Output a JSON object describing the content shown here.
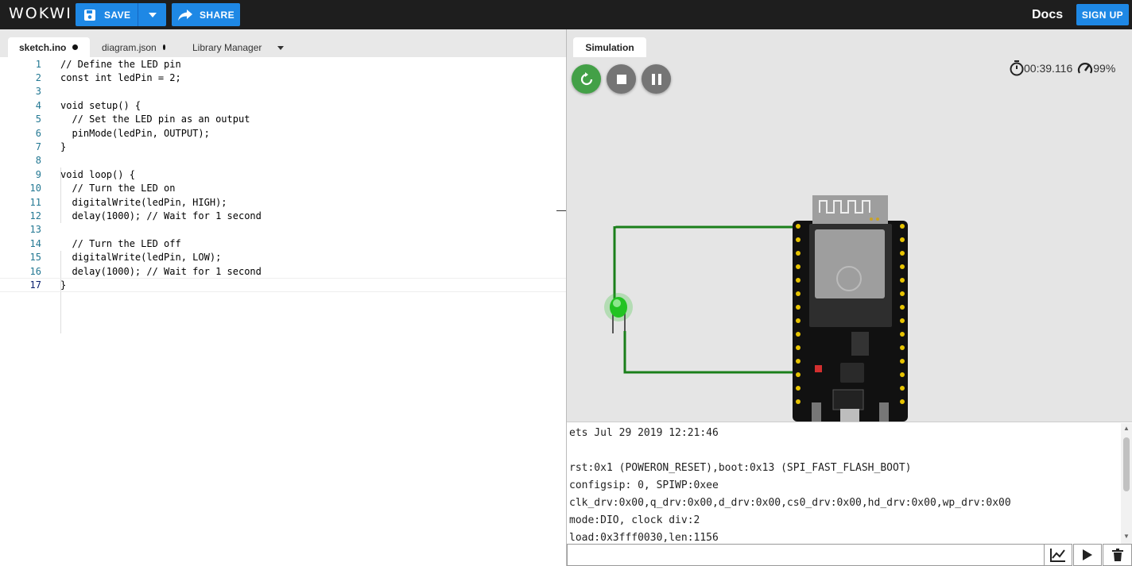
{
  "app": {
    "logo": "WOKWI"
  },
  "toolbar": {
    "save_label": "SAVE",
    "share_label": "SHARE",
    "docs_label": "Docs",
    "signup_label": "SIGN UP"
  },
  "editor": {
    "tabs": [
      {
        "label": "sketch.ino",
        "modified": true,
        "active": true
      },
      {
        "label": "diagram.json",
        "modified": true,
        "active": false
      },
      {
        "label": "Library Manager",
        "modified": false,
        "active": false
      }
    ],
    "current_line": 17,
    "lines": [
      {
        "n": "1",
        "text": "// Define the LED pin"
      },
      {
        "n": "2",
        "text": "const int ledPin = 2;"
      },
      {
        "n": "3",
        "text": ""
      },
      {
        "n": "4",
        "text": "void setup() {"
      },
      {
        "n": "5",
        "text": "  // Set the LED pin as an output"
      },
      {
        "n": "6",
        "text": "  pinMode(ledPin, OUTPUT);"
      },
      {
        "n": "7",
        "text": "}"
      },
      {
        "n": "8",
        "text": ""
      },
      {
        "n": "9",
        "text": "void loop() {"
      },
      {
        "n": "10",
        "text": "  // Turn the LED on"
      },
      {
        "n": "11",
        "text": "  digitalWrite(ledPin, HIGH);"
      },
      {
        "n": "12",
        "text": "  delay(1000); // Wait for 1 second"
      },
      {
        "n": "13",
        "text": ""
      },
      {
        "n": "14",
        "text": "  // Turn the LED off"
      },
      {
        "n": "15",
        "text": "  digitalWrite(ledPin, LOW);"
      },
      {
        "n": "16",
        "text": "  delay(1000); // Wait for 1 second"
      },
      {
        "n": "17",
        "text": "}"
      }
    ]
  },
  "simulation": {
    "tab_label": "Simulation",
    "elapsed": "00:39.116",
    "speed": "99%",
    "led_color": "#22c322",
    "wire_color": "#1a7f1a"
  },
  "console": {
    "lines": [
      "ets Jul 29 2019 12:21:46",
      "",
      "rst:0x1 (POWERON_RESET),boot:0x13 (SPI_FAST_FLASH_BOOT)",
      "configsip: 0, SPIWP:0xee",
      "clk_drv:0x00,q_drv:0x00,d_drv:0x00,cs0_drv:0x00,hd_drv:0x00,wp_drv:0x00",
      "mode:DIO, clock div:2",
      "load:0x3fff0030,len:1156"
    ],
    "input_value": ""
  },
  "icons": {
    "save": "floppy-disk-icon",
    "share": "share-arrow-icon",
    "restart": "restart-icon",
    "stop": "stop-icon",
    "pause": "pause-icon",
    "timer": "stopwatch-icon",
    "speed": "speedometer-icon",
    "plot": "line-chart-icon",
    "run": "play-icon",
    "clear": "trash-icon"
  }
}
